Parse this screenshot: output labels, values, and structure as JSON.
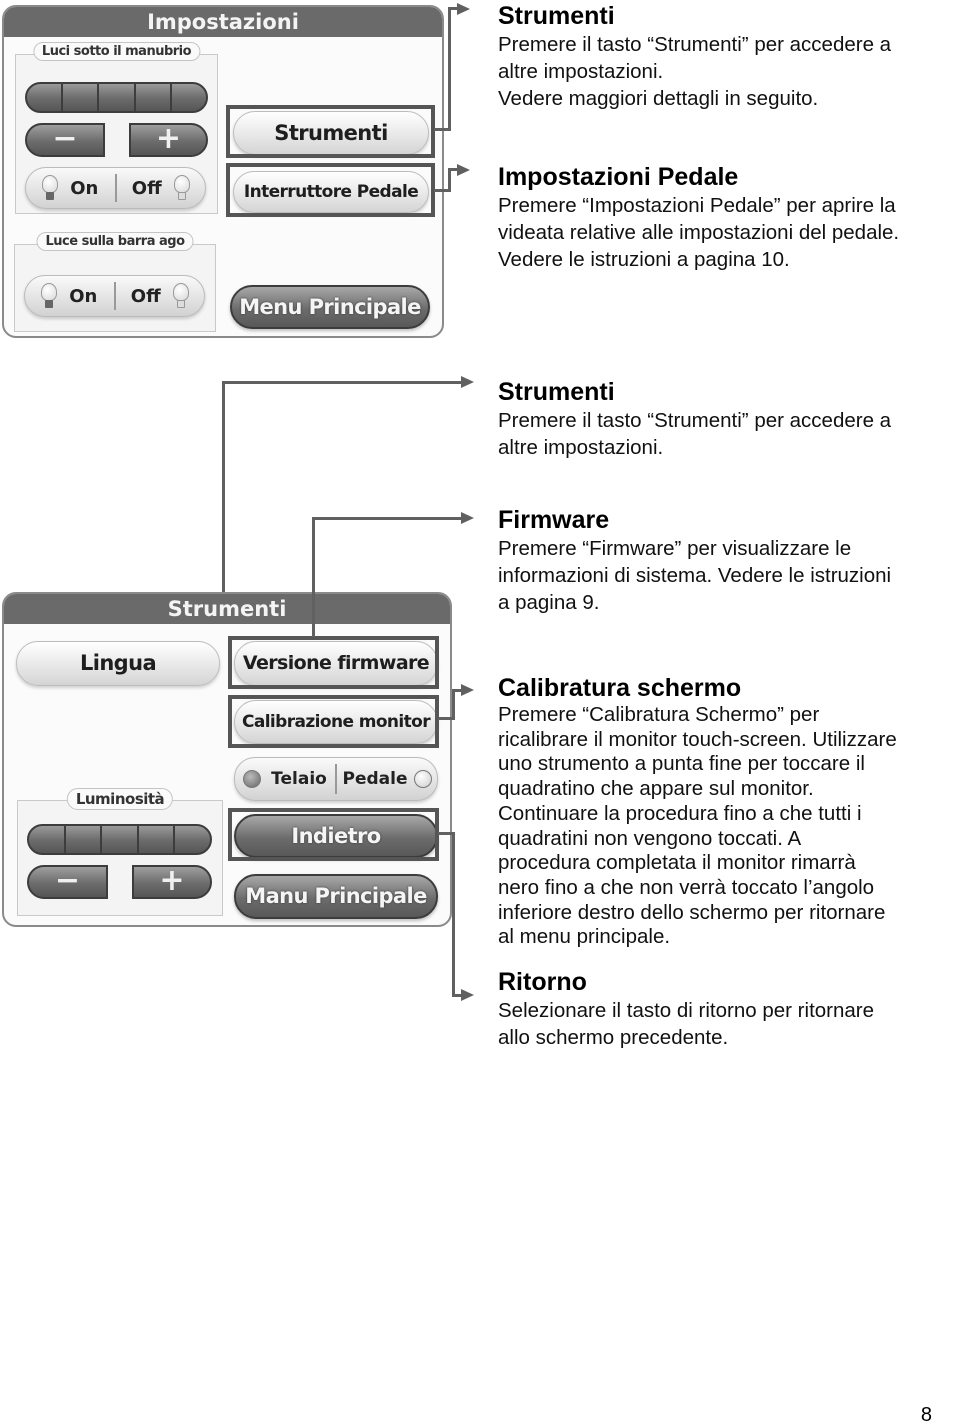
{
  "panel_impostazioni": {
    "title": "Impostazioni",
    "group_handlebar": {
      "label": "Luci sotto il manubrio",
      "slider_segments": 5,
      "minus_label": "−",
      "plus_label": "+",
      "on_label": "On",
      "off_label": "Off"
    },
    "group_needle_bar": {
      "label": "Luce sulla barra ago",
      "on_label": "On",
      "off_label": "Off"
    },
    "buttons": {
      "strumenti": "Strumenti",
      "interruttore_pedale": "Interruttore Pedale",
      "menu_principale": "Menu Principale"
    }
  },
  "panel_strumenti": {
    "title": "Strumenti",
    "buttons": {
      "lingua": "Lingua",
      "versione_firmware": "Versione firmware",
      "calibrazione_monitor": "Calibrazione monitor",
      "indietro": "Indietro",
      "menu_principale": "Manu Principale"
    },
    "toggle": {
      "left_label": "Telaio",
      "right_label": "Pedale"
    },
    "group_brightness": {
      "label": "Luminosità",
      "slider_segments": 5,
      "minus_label": "−",
      "plus_label": "+"
    }
  },
  "descriptions": {
    "strumenti_1": {
      "title": "Strumenti",
      "lines": [
        "Premere il tasto “Strumenti” per accedere a",
        "altre impostazioni.",
        "Vedere maggiori dettagli in seguito."
      ]
    },
    "impostazioni_pedale": {
      "title": "Impostazioni Pedale",
      "lines": [
        "Premere “Impostazioni Pedale” per aprire la",
        "videata relative alle impostazioni del pedale.",
        "Vedere le istruzioni a pagina 10."
      ]
    },
    "strumenti_2": {
      "title": "Strumenti",
      "lines": [
        "Premere il tasto “Strumenti” per accedere a",
        "altre impostazioni."
      ]
    },
    "firmware": {
      "title": "Firmware",
      "lines": [
        "Premere “Firmware” per visualizzare le",
        "informazioni di sistema. Vedere le istruzioni",
        "a pagina 9."
      ]
    },
    "calibratura": {
      "title": "Calibratura schermo",
      "lines": [
        "Premere “Calibratura Schermo” per",
        "ricalibrare il monitor touch-screen. Utilizzare",
        "uno strumento a punta fine per toccare il",
        "quadratino che appare sul monitor.",
        "Continuare la procedura fino a che tutti i",
        "quadratini non vengono toccati. A",
        "procedura completata il monitor rimarrà",
        "nero fino a che non verrà toccato l’angolo",
        "inferiore destro dello schermo per ritornare",
        "al menu principale."
      ]
    },
    "ritorno": {
      "title": "Ritorno",
      "lines": [
        "Selezionare il tasto di ritorno per ritornare",
        "allo schermo precedente."
      ]
    }
  },
  "page_number": "8"
}
